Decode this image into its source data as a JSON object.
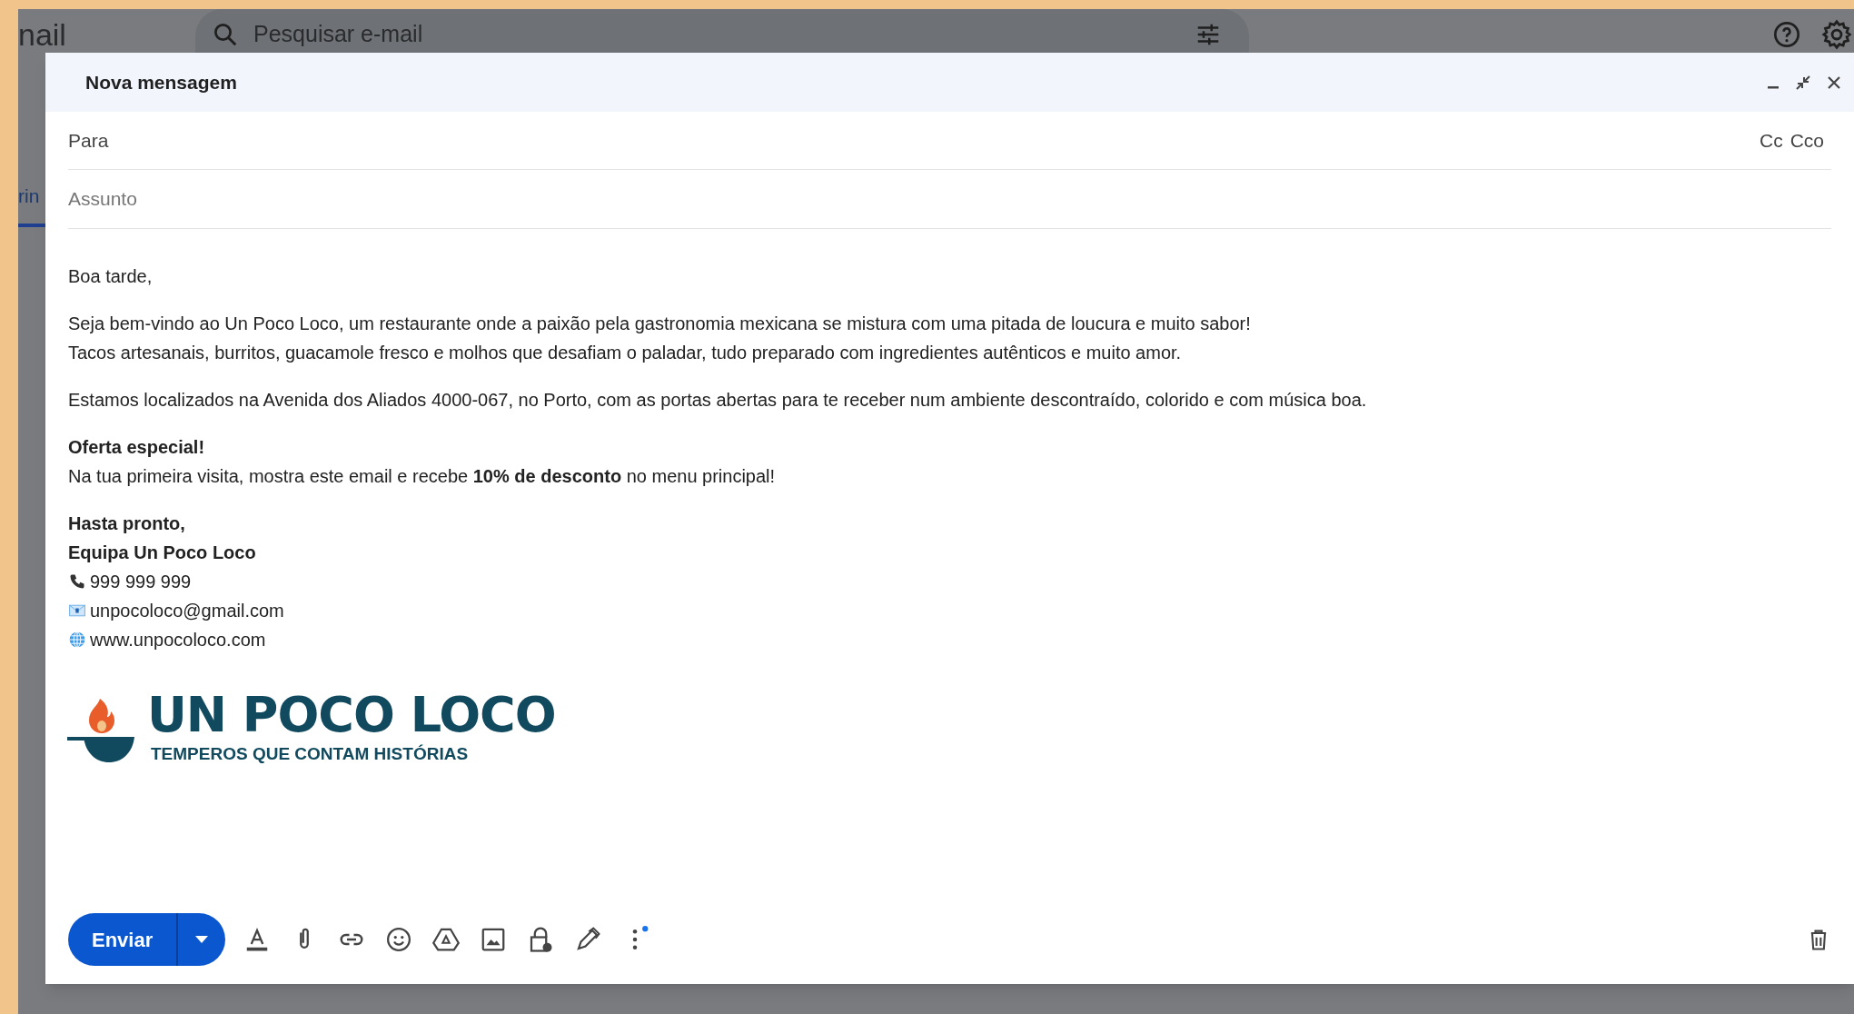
{
  "background": {
    "app_name": "nail",
    "search": {
      "placeholder": "Pesquisar e-mail"
    },
    "tab_label": "rin"
  },
  "compose": {
    "title": "Nova mensagem",
    "to_label": "Para",
    "cc": "Cc",
    "bcc": "Cco",
    "subject": {
      "placeholder": "Assunto"
    },
    "body": [
      {
        "lines": [
          {
            "text": "Boa tarde,",
            "bold": false
          }
        ]
      },
      {
        "lines": [
          {
            "text": "Seja bem-vindo ao Un Poco Loco, um restaurante onde a paixão pela gastronomia mexicana se mistura com uma pitada de loucura e muito sabor!",
            "bold": false
          },
          {
            "text": "Tacos artesanais, burritos, guacamole fresco e molhos que desafiam o paladar, tudo preparado com ingredientes autênticos e muito amor.",
            "bold": false
          }
        ]
      },
      {
        "lines": [
          {
            "text": "Estamos localizados na Avenida dos Aliados 4000-067, no Porto, com as portas abertas para te receber num ambiente descontraído, colorido e com música boa.",
            "bold": false
          }
        ]
      },
      {
        "lines": [
          {
            "text": "Oferta especial!",
            "bold": true
          },
          {
            "text": "Na tua primeira visita, mostra este email e recebe **10% de desconto** no menu principal!",
            "bold": false
          }
        ]
      },
      {
        "lines": [
          {
            "text": "Hasta pronto,",
            "bold": true
          },
          {
            "text": "Equipa Un Poco Loco",
            "bold": true
          }
        ]
      }
    ],
    "contacts": [
      {
        "kind": "phone",
        "text": "999 999 999"
      },
      {
        "kind": "email",
        "text": "unpocoloco@gmail.com"
      },
      {
        "kind": "web",
        "text": "www.unpocoloco.com"
      }
    ],
    "logo": {
      "title": "UN POCO LOCO",
      "tagline": "TEMPEROS QUE CONTAM HISTÓRIAS"
    },
    "send_button": "Enviar"
  }
}
